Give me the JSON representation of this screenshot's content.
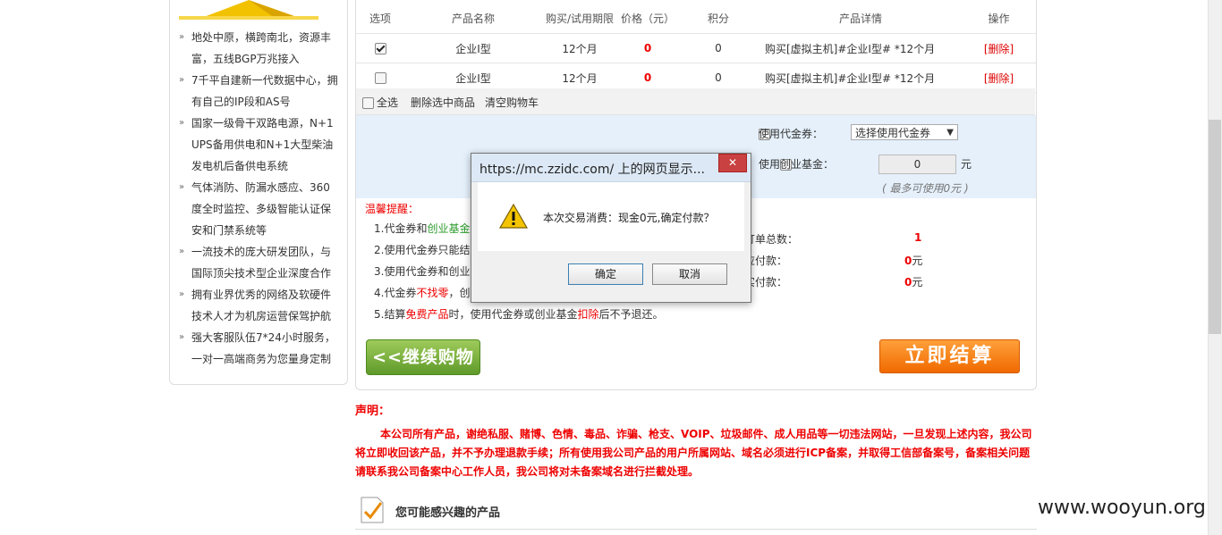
{
  "sidebar": {
    "features": [
      [
        "地处中原，横跨南北，资源丰",
        "富，五线BGP万兆接入"
      ],
      [
        "7千平自建新一代数据中心，拥",
        "有自己的IP段和AS号"
      ],
      [
        "国家一级骨干双路电源，N+1",
        "UPS备用供电和N+1大型柴油",
        "发电机后备供电系统"
      ],
      [
        "气体消防、防漏水感应、360",
        "度全时监控、多级智能认证保",
        "安和门禁系统等"
      ],
      [
        "一流技术的庞大研发团队，与",
        "国际顶尖技术型企业深度合作"
      ],
      [
        "拥有业界优秀的网络及软硬件",
        "技术人才为机房运营保驾护航"
      ],
      [
        "强大客服队伍7*24小时服务，",
        "一对一高端商务为您量身定制"
      ]
    ]
  },
  "cart": {
    "headers": [
      "选项",
      "产品名称",
      "购买/试用期限",
      "价格（元）",
      "积分",
      "产品详情",
      "操作"
    ],
    "rows": [
      {
        "checked": true,
        "name": "企业I型",
        "period": "12个月",
        "price": "0",
        "points": "0",
        "detail": "购买[虚拟主机]#企业I型# *12个月",
        "action": "[删除]"
      },
      {
        "checked": false,
        "name": "企业I型",
        "period": "12个月",
        "price": "0",
        "points": "0",
        "detail": "购买[虚拟主机]#企业I型# *12个月",
        "action": "[删除]"
      }
    ],
    "select_all": "全选",
    "delete_selected": "删除选中商品",
    "clear_cart": "清空购物车"
  },
  "coupon": {
    "use_coupon": "使用代金券：",
    "coupon_select": "选择使用代金券",
    "use_fund": "使用创业基金：",
    "fund_value": "0",
    "unit": "元",
    "fund_hint": "( 最多可使用0元 )"
  },
  "tips": {
    "title": "温馨提醒：",
    "t1_a": "1.代金券和",
    "t1_b": "创业基金",
    "t2": "2.使用代金券只能结",
    "t3": "3.使用代金券和创业",
    "t4_a": "4.代金券",
    "t4_b": "不找零",
    "t4_c": "，创",
    "t5_a": "5.结算",
    "t5_b": "免费产品",
    "t5_c": "时，使用代金券或创业基金",
    "t5_d": "扣除",
    "t5_e": "后不予退还。"
  },
  "summary": {
    "count_label": "订单总数：",
    "count_value": "1",
    "pay1_label": "应付款：",
    "pay1_value": "0",
    "pay2_label": "实付款：",
    "pay2_value": "0",
    "unit": "元"
  },
  "buttons": {
    "continue": "<<继续购物",
    "checkout": "立即结算"
  },
  "declaration": {
    "title": "声明：",
    "text": "本公司所有产品，谢绝私服、赌博、色情、毒品、诈骗、枪支、VOIP、垃圾邮件、成人用品等一切违法网站，一旦发现上述内容，我公司将立即收回该产品，并不予办理退款手续；所有使用我公司产品的用户所属网站、域名必须进行ICP备案，并取得工信部备案号，备案相关问题请联系我公司备案中心工作人员，我公司将对未备案域名进行拦截处理。"
  },
  "interest": {
    "title": "您可能感兴趣的产品"
  },
  "dialog": {
    "title": "https://mc.zzidc.com/ 上的网页显示...",
    "message": "本次交易消费：现金0元,确定付款？",
    "ok": "确定",
    "cancel": "取消",
    "close": "✕"
  },
  "watermark": "www.wooyun.org",
  "colors": {
    "accent_red": "#ee0000",
    "green": "#2a9a2a",
    "orange": "#f06a00"
  }
}
